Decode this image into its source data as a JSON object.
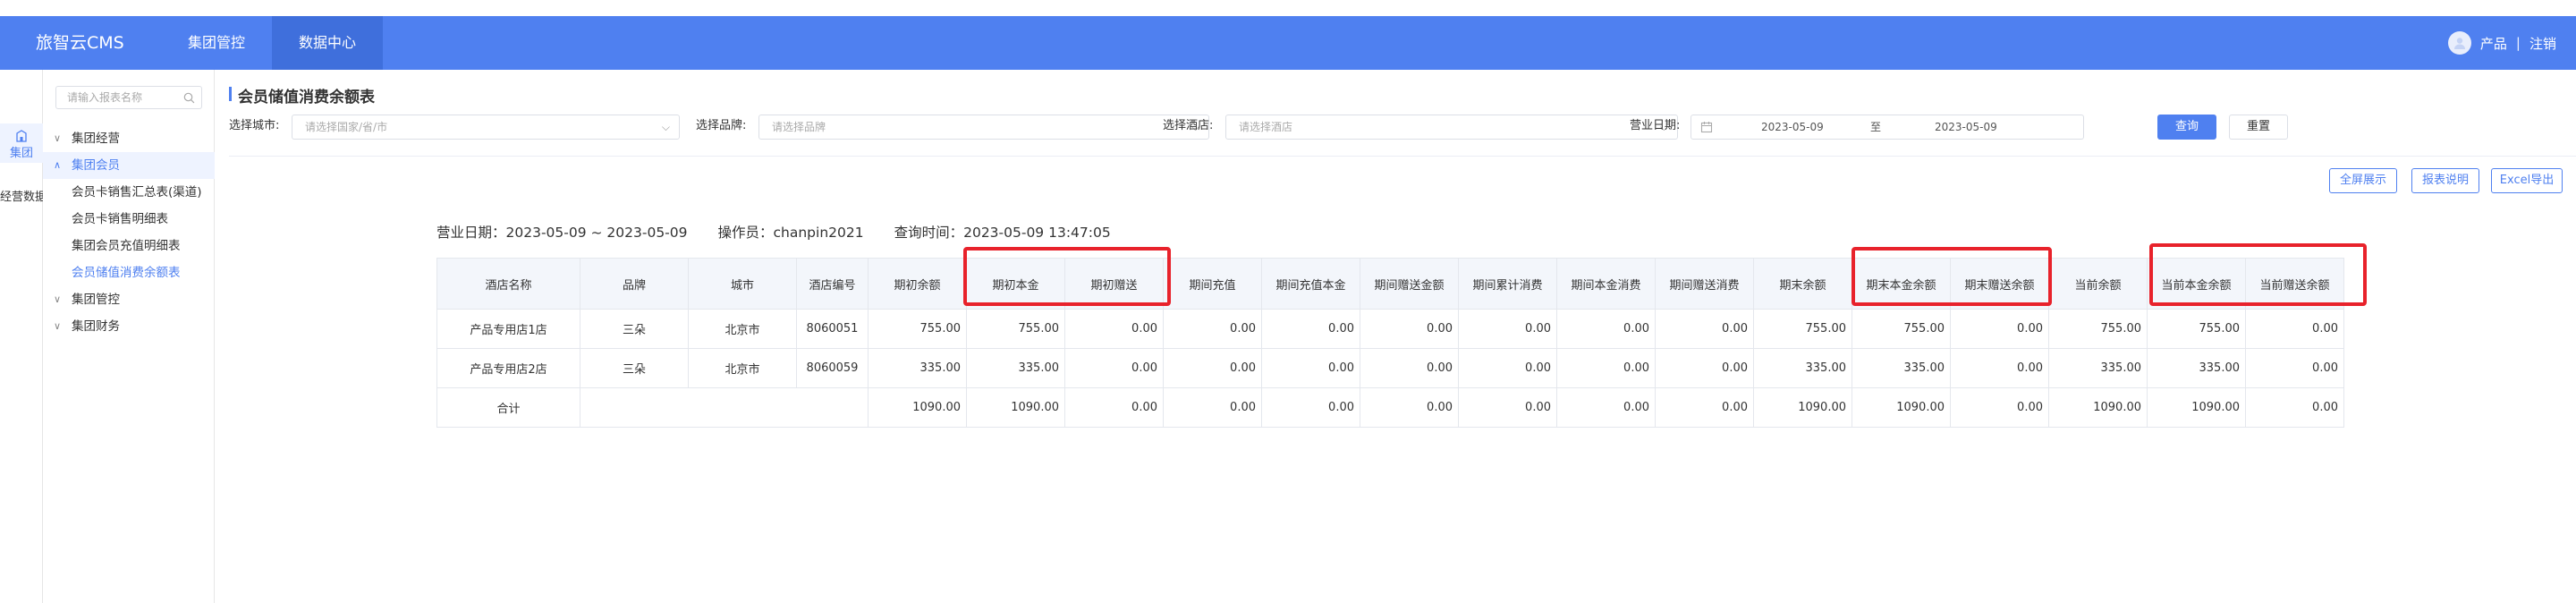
{
  "header": {
    "brand": "旅智云CMS",
    "nav": [
      "集团管控",
      "数据中心"
    ],
    "user": {
      "name": "产品",
      "separator": "|",
      "action": "注销"
    }
  },
  "rail": {
    "item_label": "集团",
    "item2_label": "经营数据"
  },
  "sidebar": {
    "search_placeholder": "请输入报表名称",
    "tree": [
      {
        "label": "集团经营",
        "caret": "∨"
      },
      {
        "label": "集团会员",
        "caret": "∧"
      },
      {
        "label": "会员卡销售汇总表(渠道)"
      },
      {
        "label": "会员卡销售明细表"
      },
      {
        "label": "集团会员充值明细表"
      },
      {
        "label": "会员储值消费余额表"
      },
      {
        "label": "集团管控",
        "caret": "∨"
      },
      {
        "label": "集团财务",
        "caret": "∨"
      }
    ]
  },
  "page": {
    "title": "会员储值消费余额表",
    "filters": {
      "city_label": "选择城市:",
      "city_placeholder": "请选择国家/省/市",
      "brand_label": "选择品牌:",
      "brand_placeholder": "请选择品牌",
      "hotel_label": "选择酒店:",
      "hotel_placeholder": "请选择酒店",
      "date_label": "营业日期:",
      "date_start": "2023-05-09",
      "date_sep": "至",
      "date_end": "2023-05-09"
    },
    "buttons": {
      "query": "查询",
      "reset": "重置",
      "fullscreen": "全屏展示",
      "explain": "报表说明",
      "export": "Excel导出"
    }
  },
  "summary": {
    "date_text": "营业日期：2023-05-09  ~  2023-05-09",
    "operator_text": "操作员：chanpin2021",
    "query_time_text": "查询时间：2023-05-09 13:47:05"
  },
  "table": {
    "columns": [
      "酒店名称",
      "品牌",
      "城市",
      "酒店编号",
      "期初余额",
      "期初本金",
      "期初赠送",
      "期间充值",
      "期间充值本金",
      "期间赠送金额",
      "期间累计消费",
      "期间本金消费",
      "期间赠送消费",
      "期末余额",
      "期末本金余额",
      "期末赠送余额",
      "当前余额",
      "当前本金余额",
      "当前赠送余额"
    ],
    "rows": [
      [
        "产品专用店1店",
        "三朵",
        "北京市",
        "8060051",
        "755.00",
        "755.00",
        "0.00",
        "0.00",
        "0.00",
        "0.00",
        "0.00",
        "0.00",
        "0.00",
        "755.00",
        "755.00",
        "0.00",
        "755.00",
        "755.00",
        "0.00"
      ],
      [
        "产品专用店2店",
        "三朵",
        "北京市",
        "8060059",
        "335.00",
        "335.00",
        "0.00",
        "0.00",
        "0.00",
        "0.00",
        "0.00",
        "0.00",
        "0.00",
        "335.00",
        "335.00",
        "0.00",
        "335.00",
        "335.00",
        "0.00"
      ]
    ],
    "total_label": "合计",
    "total": [
      "1090.00",
      "1090.00",
      "0.00",
      "0.00",
      "0.00",
      "0.00",
      "0.00",
      "0.00",
      "0.00",
      "1090.00",
      "1090.00",
      "0.00",
      "1090.00",
      "1090.00",
      "0.00"
    ]
  },
  "highlight_color": "#e8222b",
  "accent_color": "#4f80f0"
}
